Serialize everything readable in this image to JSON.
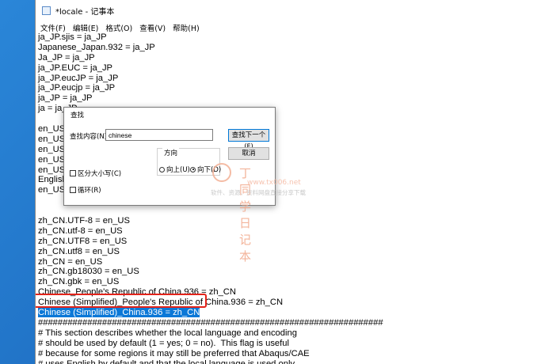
{
  "window": {
    "title": "*locale - 记事本"
  },
  "menu": [
    "文件(F)",
    "编辑(E)",
    "格式(O)",
    "查看(V)",
    "帮助(H)"
  ],
  "lines": [
    "ja_JP.sjis = ja_JP",
    "Japanese_Japan.932 = ja_JP",
    "Ja_JP = ja_JP",
    "ja_JP.EUC = ja_JP",
    "ja_JP.eucJP = ja_JP",
    "ja_JP.eucjp = ja_JP",
    "ja_JP = ja_JP",
    "ja = ja_JP",
    "",
    "en_US.U",
    "en_US.u",
    "en_US.U",
    "en_US.u",
    "en_US.is",
    "English_",
    "en_US.I",
    "",
    "",
    "zh_CN.UTF-8 = en_US",
    "zh_CN.utf-8 = en_US",
    "zh_CN.UTF8 = en_US",
    "zh_CN.utf8 = en_US",
    "zh_CN = en_US",
    "zh_CN.gb18030 = en_US",
    "zh_CN.gbk = en_US",
    "Chinese_People's Republic of China.936 = zh_CN",
    "Chinese (Simplified)_People's Republic of China.936 = zh_CN",
    "Chinese (Simplified)_China.936 = zh_CN",
    "######################################################################",
    "# This section describes whether the local language and encoding",
    "# should be used by default (1 = yes; 0 = no).  This flag is useful",
    "# because for some regions it may still be preferred that Abaqus/CAE",
    "# uses English by default and that the local language is used only"
  ],
  "selected_line_index": 27,
  "find_dialog": {
    "title": "查找",
    "find_label": "查找内容(N):",
    "find_value": "chinese",
    "find_next_button": "查找下一个(F)",
    "cancel_button": "取消",
    "direction_label": "方向",
    "up_label": "向上(U)",
    "down_label": "向下(D)",
    "direction_selected": "down",
    "match_case_label": "区分大小写(C)",
    "wrap_label": "循环(R)"
  },
  "watermark": {
    "title": "丁同学日记本",
    "url": "www.tx006.net",
    "subtitle": "软件、资源、资料网盘直接分享下载"
  }
}
